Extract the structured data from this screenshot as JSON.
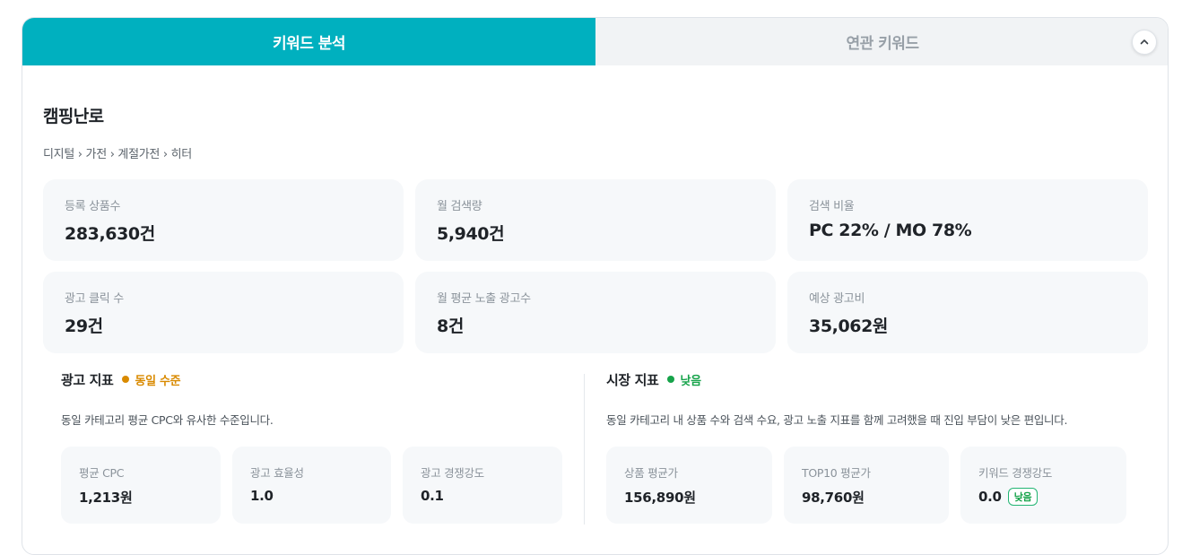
{
  "tabs": [
    {
      "label": "키워드 분석",
      "active": true
    },
    {
      "label": "연관 키워드",
      "active": false
    }
  ],
  "keyword": "캠핑난로",
  "breadcrumb": [
    "디지털",
    "가전",
    "계절가전",
    "히터"
  ],
  "breadcrumb_text": "디지털 › 가전 › 계절가전 › 히터",
  "metrics": [
    {
      "label": "등록 상품수",
      "value": "283,630건"
    },
    {
      "label": "월 검색량",
      "value": "5,940건"
    },
    {
      "label": "검색 비율",
      "value": "PC 22% / MO 78%"
    },
    {
      "label": "광고 클릭 수",
      "value": "29건"
    },
    {
      "label": "월 평균 노출 광고수",
      "value": "8건"
    },
    {
      "label": "예상 광고비",
      "value": "35,062원"
    }
  ],
  "ad_indicator": {
    "title": "광고 지표",
    "status": "동일 수준",
    "status_color": "#d98a00",
    "description": "동일 카테고리 평균 CPC와 유사한 수준입니다.",
    "items": [
      {
        "label": "평균 CPC",
        "value": "1,213원"
      },
      {
        "label": "광고 효율성",
        "value": "1.0"
      },
      {
        "label": "광고 경쟁강도",
        "value": "0.1"
      }
    ]
  },
  "market_indicator": {
    "title": "시장 지표",
    "status": "낮음",
    "status_color": "#16a34a",
    "description": "동일 카테고리 내 상품 수와 검색 수요, 광고 노출 지표를 함께 고려했을 때 진입 부담이 낮은 편입니다.",
    "items": [
      {
        "label": "상품 평균가",
        "value": "156,890원"
      },
      {
        "label": "TOP10 평균가",
        "value": "98,760원"
      },
      {
        "label": "키워드 경쟁강도",
        "value": "0.0",
        "badge": "낮음"
      }
    ]
  },
  "colors": {
    "accent": "#00b0bf",
    "card_bg": "#f6f8fa"
  },
  "icons": {
    "collapse": "chevron-up-icon"
  }
}
